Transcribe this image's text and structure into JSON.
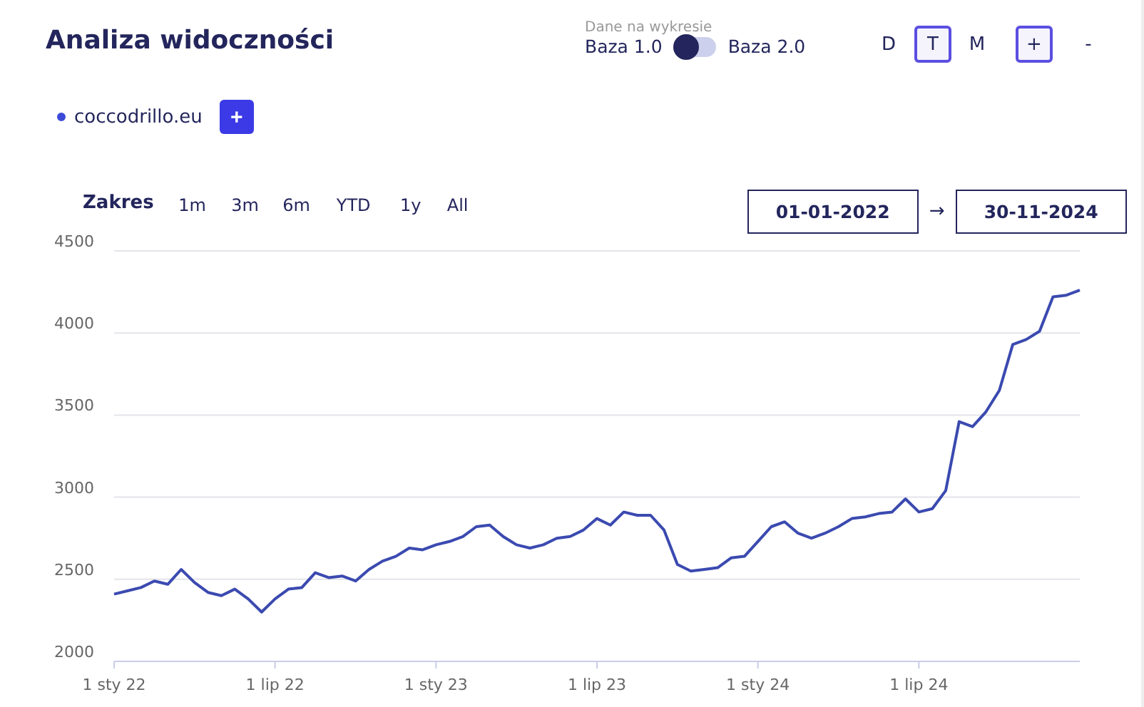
{
  "title": "Analiza widoczności",
  "data_source": {
    "caption": "Dane na wykresie",
    "left_label": "Baza 1.0",
    "right_label": "Baza 2.0",
    "on": false
  },
  "granularity": [
    {
      "label": "D",
      "selected": false
    },
    {
      "label": "T",
      "selected": true
    },
    {
      "label": "M",
      "selected": false
    }
  ],
  "zoom_buttons": [
    {
      "label": "+",
      "disabled": false
    },
    {
      "label": "-",
      "disabled": true
    }
  ],
  "legend": [
    {
      "label": "coccodrillo.eu",
      "color": "#3b4ad8"
    }
  ],
  "add_button": "+",
  "range": {
    "label": "Zakres",
    "options": [
      "1m",
      "3m",
      "6m",
      "YTD",
      "1y",
      "All"
    ],
    "from": "01-01-2022",
    "arrow": "→",
    "to": "30-11-2024"
  },
  "chart_data": {
    "type": "line",
    "grid": true,
    "ylim": [
      2000,
      4500
    ],
    "yticks": [
      2000,
      2500,
      3000,
      3500,
      4000,
      4500
    ],
    "categories": [
      "1 sty 22",
      null,
      null,
      null,
      null,
      null,
      null,
      null,
      null,
      null,
      null,
      null,
      "1 lip 22",
      null,
      null,
      null,
      null,
      null,
      null,
      null,
      null,
      null,
      null,
      null,
      "1 sty 23",
      null,
      null,
      null,
      null,
      null,
      null,
      null,
      null,
      null,
      null,
      null,
      "1 lip 23",
      null,
      null,
      null,
      null,
      null,
      null,
      null,
      null,
      null,
      null,
      null,
      "1 sty 24",
      null,
      null,
      null,
      null,
      null,
      null,
      null,
      null,
      null,
      null,
      null,
      "1 lip 24",
      null,
      null,
      null,
      null,
      null,
      null,
      null,
      null,
      null,
      null,
      null,
      null
    ],
    "series": [
      {
        "color": "#3b4ab0",
        "values": [
          2410,
          2430,
          2450,
          2490,
          2470,
          2560,
          2480,
          2420,
          2400,
          2440,
          2380,
          2300,
          2380,
          2440,
          2450,
          2540,
          2510,
          2520,
          2490,
          2560,
          2610,
          2640,
          2690,
          2680,
          2710,
          2730,
          2760,
          2820,
          2830,
          2760,
          2710,
          2690,
          2710,
          2750,
          2760,
          2800,
          2870,
          2830,
          2910,
          2890,
          2890,
          2800,
          2590,
          2550,
          2560,
          2570,
          2630,
          2640,
          2730,
          2820,
          2850,
          2780,
          2750,
          2780,
          2820,
          2870,
          2880,
          2900,
          2910,
          2990,
          2910,
          2930,
          3040,
          3460,
          3430,
          3520,
          3650,
          3930,
          3960,
          4010,
          4220,
          4230,
          4260
        ]
      }
    ]
  }
}
